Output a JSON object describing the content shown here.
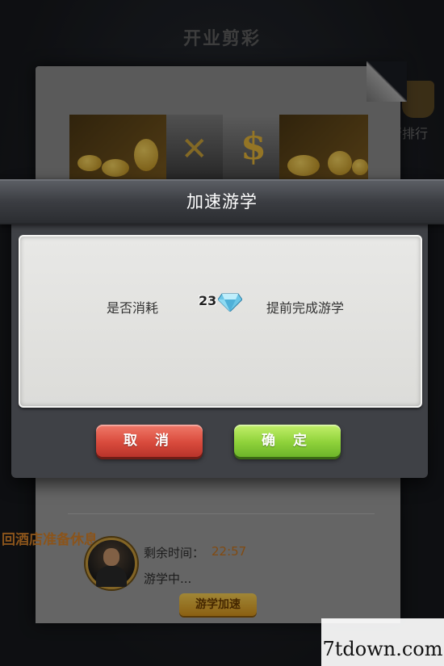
{
  "background": {
    "title": "开业剪彩",
    "right_label": "行排行",
    "return_notice": "回酒店准备休息",
    "remaining_label": "剩余时间：",
    "remaining_value": "22:57",
    "status": "游学中...",
    "speedup_button": "游学加速"
  },
  "dialog": {
    "title": "加速游学",
    "message_prefix": "是否消耗",
    "diamond_count": "23",
    "message_suffix": "提前完成游学",
    "cancel_label": "取 消",
    "confirm_label": "确 定"
  },
  "watermark": {
    "text": "7tdown.com"
  },
  "colors": {
    "cancel": "#d94b3d",
    "confirm": "#8fd23a",
    "accent_orange": "#d5822a",
    "diamond": "#7fd0ea"
  }
}
